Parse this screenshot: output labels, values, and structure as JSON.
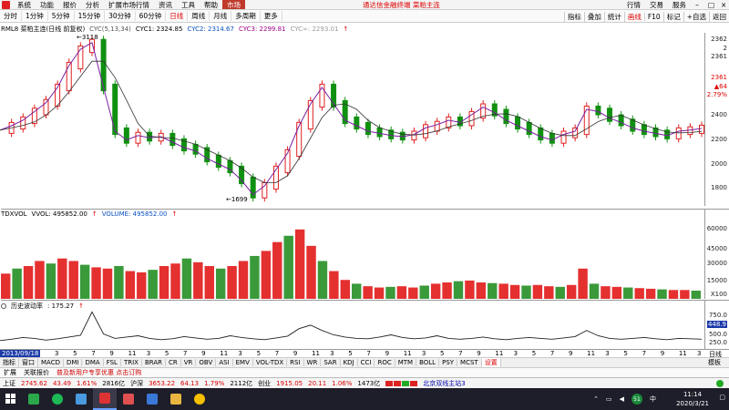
{
  "menubar": {
    "items": [
      "系统",
      "功能",
      "报价",
      "分析",
      "扩展市场行情",
      "资讯",
      "工具",
      "帮助"
    ],
    "active_item": "市场",
    "center_text": "通达信金融终端 菜粕主连",
    "right_items": [
      "行情",
      "交易",
      "服务"
    ],
    "win_minimize": "–",
    "win_maximize": "□",
    "win_close": "×"
  },
  "periodbar": {
    "items": [
      "分时",
      "1分钟",
      "5分钟",
      "15分钟",
      "30分钟",
      "60分钟",
      "日线",
      "周线",
      "月线",
      "多周期",
      "更多"
    ],
    "active": "日线",
    "right_items": [
      "指标",
      "叠加",
      "统计",
      "画线",
      "F10",
      "标记",
      "+自选",
      "返回"
    ],
    "right_active": "画线"
  },
  "main_label": {
    "name": "RML8 菜粕主连(日线 前复权)",
    "cyc": "CYC(5,13,34)",
    "cyc1": "CYC1: 2324.85",
    "cyc2": "CYC2: 2314.67",
    "cyc3": "CYC3: 2299.81",
    "cycx": "CYC∞: 2293.01"
  },
  "volume_label": {
    "name": "TDXVOL",
    "vvol": "VVOL: 495852.00",
    "volume": "VOLUME: 495852.00"
  },
  "hv_label": {
    "name": "历史波动率",
    "value": ": 175.27"
  },
  "price_axis": {
    "ticks": [
      "2400",
      "2200",
      "2000",
      "1800"
    ],
    "current": "2362",
    "current2": "2",
    "price2": "2361",
    "change": "▲64",
    "pct": "2.79%",
    "high_mark": "3118",
    "low_mark": "1699"
  },
  "volume_axis": {
    "ticks": [
      "60000",
      "45000",
      "30000",
      "15000"
    ],
    "unit": "X100"
  },
  "hv_axis": {
    "ticks": [
      "750.0",
      "500.0",
      "250.0"
    ],
    "current": "448.9"
  },
  "datebar": {
    "selected": "2013/09/18",
    "ticks": [
      "3",
      "5",
      "7",
      "9",
      "11",
      "3",
      "5",
      "7",
      "9",
      "11",
      "3",
      "5",
      "7",
      "9",
      "11",
      "3",
      "5",
      "7",
      "9",
      "11",
      "3",
      "5",
      "7",
      "9",
      "11",
      "3",
      "5",
      "7",
      "9",
      "11",
      "3",
      "5",
      "7",
      "9",
      "11",
      "3"
    ],
    "right_label": "日线"
  },
  "tabbar": {
    "tabs": [
      "指标",
      "窗口",
      "MACD",
      "DMI",
      "DMA",
      "FSL",
      "TRIX",
      "BRAR",
      "CR",
      "VR",
      "OBV",
      "ASI",
      "EMV",
      "VOL-TDX",
      "RSI",
      "WR",
      "SAR",
      "KDJ",
      "CCI",
      "ROC",
      "MTM",
      "BOLL",
      "PSY",
      "MCST",
      "设置"
    ],
    "active": "设置",
    "right": "模板"
  },
  "extbar": {
    "items": [
      "扩展",
      "关联报价",
      "普及新用户专享优惠 点击订购"
    ]
  },
  "statusbar": {
    "sh_label": "上证",
    "sh_value": "2745.62",
    "sh_change": "43.49",
    "sh_pct": "1.61%",
    "sh_amount": "2816亿",
    "hs_label": "沪深",
    "hs_value": "3653.22",
    "hs_change": "64.13",
    "hs_pct": "1.79%",
    "hs_amount": "2112亿",
    "cy_label": "创业",
    "cy_value": "1915.05",
    "cy_change": "20.11",
    "cy_pct": "1.06%",
    "cy_amount": "1473亿",
    "server": "北京双线主站3"
  },
  "taskbar": {
    "time": "11:14",
    "date": "2020/3/21",
    "lang": "中"
  },
  "colors": {
    "up": "#e02020",
    "down": "#109010",
    "accent": "#c0392b",
    "cyc_line": "#7a1fa0"
  },
  "chart_data": [
    {
      "type": "line",
      "title": "RML8 菜粕主连(日线 前复权)",
      "series": [
        {
          "name": "CYC1",
          "values": [
            2310,
            2350,
            2400,
            2480,
            2560,
            2700,
            2900,
            3050,
            3110,
            2700,
            2300,
            2220,
            2260,
            2240,
            2250,
            2200,
            2150,
            2120,
            2050,
            2000,
            1950,
            1850,
            1720,
            1800,
            1950,
            2100,
            2350,
            2550,
            2700,
            2550,
            2400,
            2350,
            2300,
            2280,
            2260,
            2250,
            2270,
            2330,
            2360,
            2400,
            2380,
            2450,
            2520,
            2470,
            2400,
            2350,
            2300,
            2250,
            2220,
            2270,
            2300,
            2500,
            2480,
            2420,
            2380,
            2330,
            2300,
            2280,
            2260,
            2300,
            2310,
            2325
          ]
        }
      ],
      "ylim": [
        1650,
        3150
      ]
    },
    {
      "type": "bar",
      "title": "TDXVOL",
      "series": [
        {
          "name": "VOLUME",
          "values": [
            20000,
            24000,
            26000,
            30000,
            28000,
            32000,
            30000,
            27000,
            25000,
            24000,
            26000,
            22000,
            21000,
            23000,
            26000,
            28000,
            32000,
            29000,
            26000,
            24000,
            26000,
            30000,
            34000,
            38000,
            45000,
            50000,
            55000,
            42000,
            30000,
            22000,
            15000,
            12000,
            10000,
            9000,
            9500,
            10000,
            9000,
            10500,
            12000,
            13000,
            14000,
            14500,
            13000,
            12500,
            12000,
            11000,
            10500,
            11000,
            10000,
            9500,
            11000,
            24000,
            12000,
            10000,
            9500,
            9000,
            8500,
            8000,
            7500,
            7000,
            7000,
            6500
          ]
        }
      ],
      "ylim": [
        0,
        65000
      ]
    },
    {
      "type": "line",
      "title": "历史波动率",
      "series": [
        {
          "name": "历史波动率",
          "values": [
            250,
            280,
            320,
            300,
            260,
            290,
            330,
            370,
            900,
            400,
            300,
            330,
            360,
            300,
            270,
            290,
            340,
            310,
            280,
            300,
            360,
            320,
            290,
            270,
            310,
            350,
            520,
            600,
            480,
            380,
            330,
            300,
            290,
            330,
            380,
            320,
            290,
            310,
            360,
            300,
            280,
            300,
            330,
            290,
            270,
            300,
            320,
            300,
            280,
            310,
            340,
            480,
            360,
            300,
            280,
            300,
            320,
            290,
            270,
            300,
            290,
            280
          ]
        }
      ],
      "ylim": [
        100,
        950
      ]
    }
  ]
}
